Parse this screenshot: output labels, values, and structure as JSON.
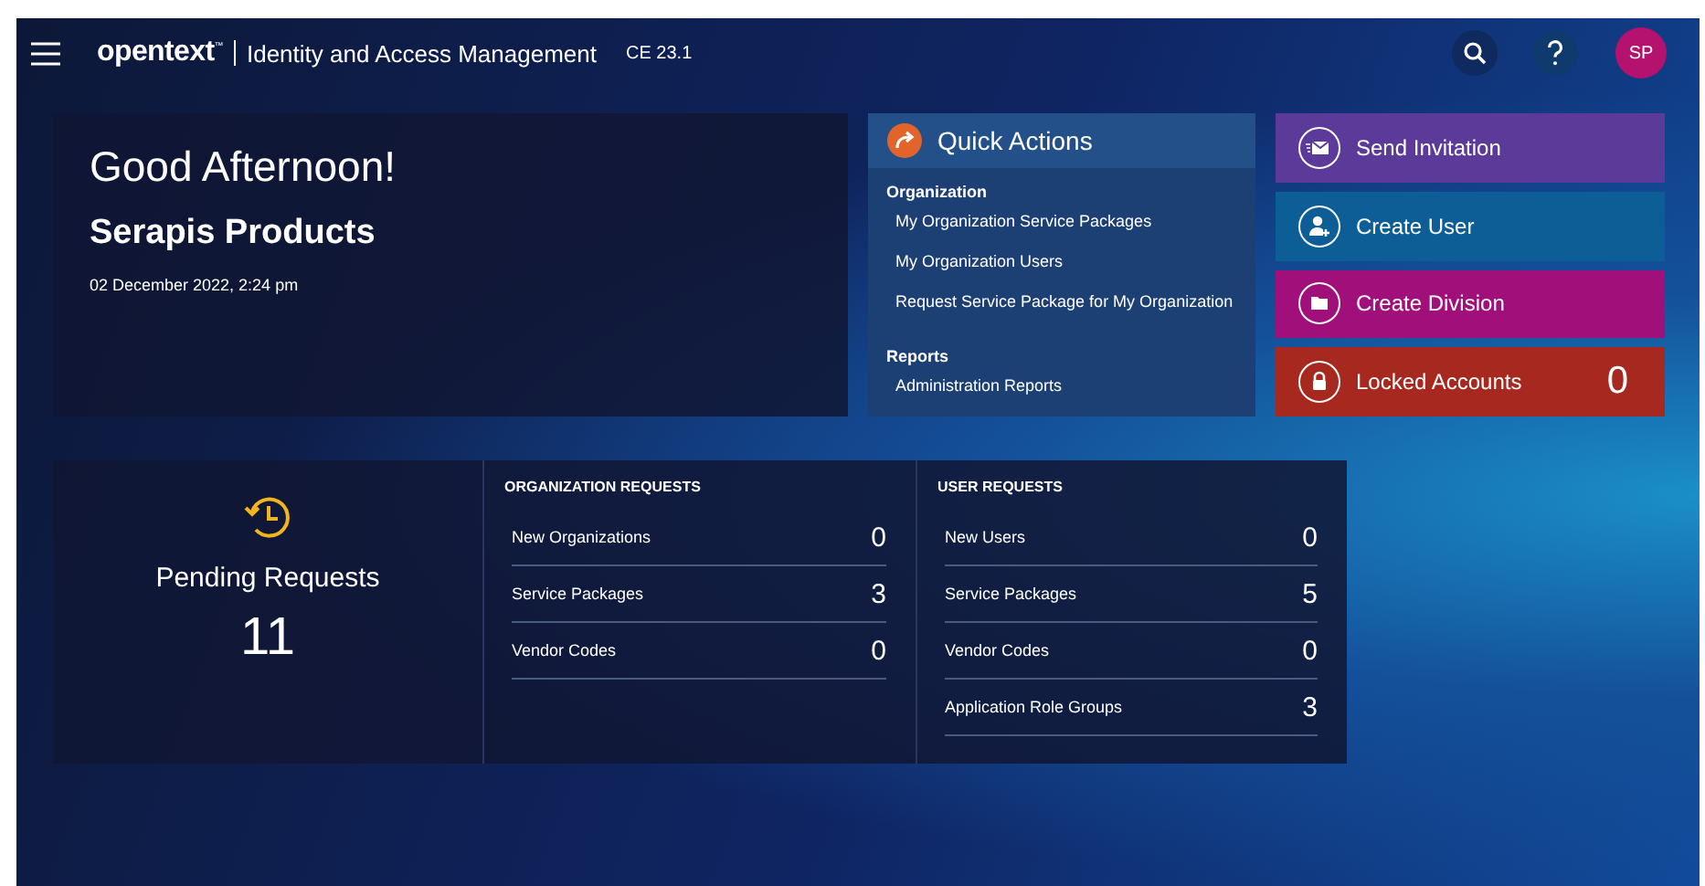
{
  "header": {
    "brand": "opentext",
    "trademark": "™",
    "product": "Identity and Access Management",
    "version": "CE 23.1",
    "avatar": "SP"
  },
  "greeting": {
    "title": "Good Afternoon!",
    "organization": "Serapis Products",
    "date": "02 December 2022, 2:24 pm"
  },
  "quick_actions": {
    "title": "Quick Actions",
    "sections": [
      {
        "heading": "Organization",
        "links": [
          "My Organization Service Packages",
          "My Organization Users",
          "Request Service Package for My Organization"
        ]
      },
      {
        "heading": "Reports",
        "links": [
          "Administration Reports"
        ]
      }
    ]
  },
  "action_buttons": [
    {
      "kind": "mail",
      "label": "Send Invitation",
      "color": "#5b3a9a"
    },
    {
      "kind": "user",
      "label": "Create User",
      "color": "#0d5e96"
    },
    {
      "kind": "folder",
      "label": "Create Division",
      "color": "#a10f7a"
    },
    {
      "kind": "lock",
      "label": "Locked Accounts",
      "color": "#a6281e",
      "count": "0"
    }
  ],
  "pending": {
    "title": "Pending Requests",
    "total": "11",
    "groups": [
      {
        "title": "ORGANIZATION REQUESTS",
        "rows": [
          {
            "label": "New Organizations",
            "value": "0"
          },
          {
            "label": "Service Packages",
            "value": "3"
          },
          {
            "label": "Vendor Codes",
            "value": "0"
          }
        ]
      },
      {
        "title": "USER REQUESTS",
        "rows": [
          {
            "label": "New Users",
            "value": "0"
          },
          {
            "label": "Service Packages",
            "value": "5"
          },
          {
            "label": "Vendor Codes",
            "value": "0"
          },
          {
            "label": "Application Role Groups",
            "value": "3"
          }
        ]
      }
    ]
  }
}
